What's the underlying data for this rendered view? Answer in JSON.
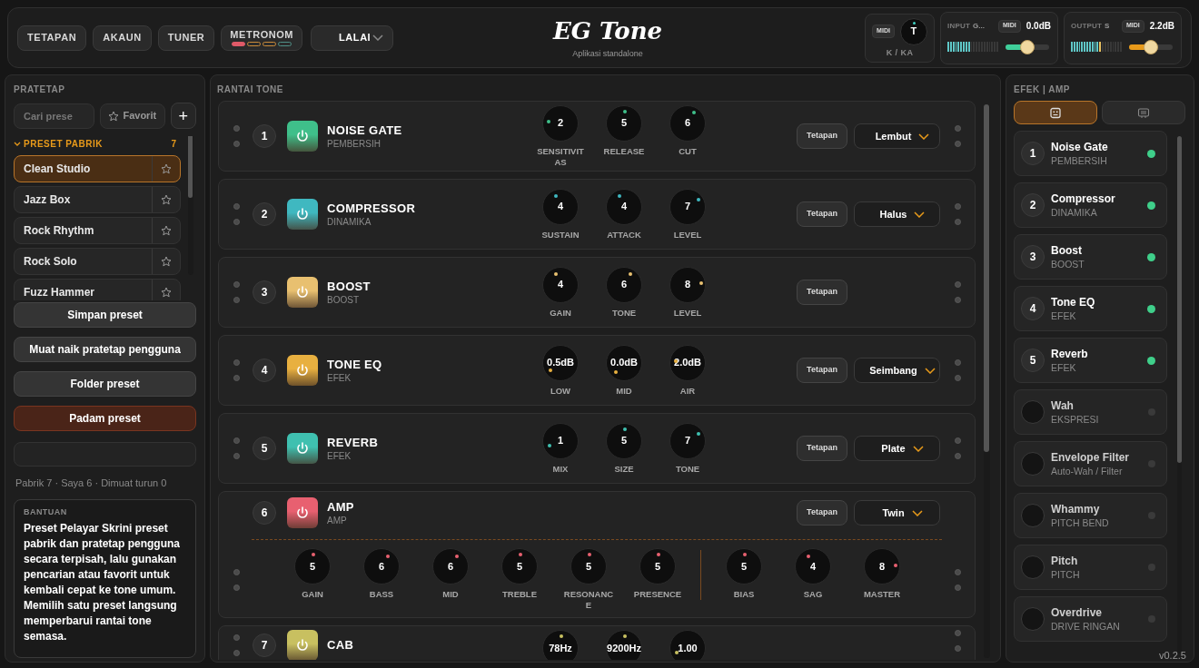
{
  "header": {
    "buttons": [
      "TETAPAN",
      "AKAUN",
      "TUNER"
    ],
    "metronome": {
      "label": "METRONOM",
      "beats": [
        {
          "color": "#e05a68",
          "on": true
        },
        {
          "color": "#c98a3a",
          "on": false
        },
        {
          "color": "#c98a3a",
          "on": false
        },
        {
          "color": "#4f8f86",
          "on": false
        }
      ]
    },
    "profile_select": {
      "value": "LALAI"
    },
    "logo": "EG Tone",
    "subtitle": "Aplikasi standalone",
    "midi_knob": {
      "midi": "MIDI",
      "knob": "T",
      "label": "K / KA"
    },
    "channels": [
      {
        "label": "INPUT",
        "name": "G...",
        "midi": "MIDI",
        "reading": "0.0dB",
        "meter": {
          "level": 0.45
        },
        "slider": {
          "level": 0.5
        },
        "color": "#3fcf9a"
      },
      {
        "label": "OUTPUT",
        "name": "S",
        "midi": "MIDI",
        "reading": "2.2dB",
        "meter": {
          "level": 0.6
        },
        "slider": {
          "level": 0.5
        },
        "color": "#e89a1a"
      }
    ]
  },
  "presets": {
    "title": "PRATETAP",
    "search": {
      "placeholder": "Cari prese"
    },
    "favorites_button": "Favorit",
    "add_button": "+",
    "group": {
      "title": "PRESET PABRIK",
      "count": "7",
      "expanded": true
    },
    "items": [
      {
        "name": "Clean Studio",
        "selected": true
      },
      {
        "name": "Jazz Box",
        "selected": false
      },
      {
        "name": "Rock Rhythm",
        "selected": false
      },
      {
        "name": "Rock Solo",
        "selected": false
      },
      {
        "name": "Fuzz Hammer",
        "selected": false
      }
    ],
    "actions": [
      {
        "label": "Simpan preset",
        "kind": "normal"
      },
      {
        "label": "Muat naik pratetap pengguna",
        "kind": "normal"
      },
      {
        "label": "Folder preset",
        "kind": "normal"
      },
      {
        "label": "Padam preset",
        "kind": "danger"
      }
    ],
    "stats": "Pabrik 7 · Saya 6 · Dimuat turun 0",
    "help": {
      "title": "BANTUAN",
      "text": "Preset Pelayar Skrini preset pabrik dan pratetap pengguna secara terpisah, lalu gunakan pencarian atau favorit untuk kembali cepat ke tone umum. Memilih satu preset langsung memperbarui rantai tone semasa."
    }
  },
  "chain": {
    "title": "RANTAI TONE",
    "modules": [
      {
        "kind": "standard",
        "number": "1",
        "name": "NOISE GATE",
        "category": "PEMBERSIH",
        "color": "#3fbf8a",
        "knobs": [
          {
            "label": "SENSITIVITAS",
            "value": "2"
          },
          {
            "label": "RELEASE",
            "value": "5"
          },
          {
            "label": "CUT",
            "value": "6"
          }
        ],
        "preset_button": "Tetapan",
        "variant": "Lembut"
      },
      {
        "kind": "standard",
        "number": "2",
        "name": "COMPRESSOR",
        "category": "DINAMIKA",
        "color": "#3fb8c0",
        "knobs": [
          {
            "label": "SUSTAIN",
            "value": "4"
          },
          {
            "label": "ATTACK",
            "value": "4"
          },
          {
            "label": "LEVEL",
            "value": "7"
          }
        ],
        "preset_button": "Tetapan",
        "variant": "Halus"
      },
      {
        "kind": "standard",
        "number": "3",
        "name": "BOOST",
        "category": "BOOST",
        "color": "#e8c070",
        "knobs": [
          {
            "label": "GAIN",
            "value": "4"
          },
          {
            "label": "TONE",
            "value": "6"
          },
          {
            "label": "LEVEL",
            "value": "8"
          }
        ],
        "preset_button": "Tetapan"
      },
      {
        "kind": "standard",
        "number": "4",
        "name": "TONE EQ",
        "category": "EFEK",
        "color": "#e8b040",
        "knobs": [
          {
            "label": "LOW",
            "value": "0.5dB"
          },
          {
            "label": "MID",
            "value": "0.0dB"
          },
          {
            "label": "AIR",
            "value": "2.0dB"
          }
        ],
        "preset_button": "Tetapan",
        "variant": "Seimbang"
      },
      {
        "kind": "standard",
        "number": "5",
        "name": "REVERB",
        "category": "EFEK",
        "color": "#3fc0b0",
        "knobs": [
          {
            "label": "MIX",
            "value": "1"
          },
          {
            "label": "SIZE",
            "value": "5"
          },
          {
            "label": "TONE",
            "value": "7"
          }
        ],
        "preset_button": "Tetapan",
        "variant": "Plate"
      },
      {
        "kind": "amp",
        "number": "6",
        "name": "AMP",
        "category": "AMP",
        "color": "#e86070",
        "knob_groups": [
          [
            {
              "label": "GAIN",
              "value": "5"
            },
            {
              "label": "BASS",
              "value": "6"
            },
            {
              "label": "MID",
              "value": "6"
            },
            {
              "label": "TREBLE",
              "value": "5"
            },
            {
              "label": "RESONANCE",
              "value": "5"
            },
            {
              "label": "PRESENCE",
              "value": "5"
            }
          ],
          [
            {
              "label": "BIAS",
              "value": "5"
            },
            {
              "label": "SAG",
              "value": "4"
            },
            {
              "label": "MASTER",
              "value": "8"
            }
          ]
        ],
        "preset_button": "Tetapan",
        "variant": "Twin"
      },
      {
        "kind": "standard",
        "number": "7",
        "name": "CAB",
        "color": "#c8c060",
        "knobs": [
          {
            "value": "78Hz"
          },
          {
            "value": "9200Hz"
          },
          {
            "value": "1.00"
          }
        ]
      }
    ]
  },
  "effects": {
    "title": "EFEK | AMP",
    "tabs": [
      {
        "selected": true
      },
      {
        "selected": false
      }
    ],
    "items": [
      {
        "number": "1",
        "name": "Noise Gate",
        "category": "PEMBERSIH",
        "active": true
      },
      {
        "number": "2",
        "name": "Compressor",
        "category": "DINAMIKA",
        "active": true
      },
      {
        "number": "3",
        "name": "Boost",
        "category": "BOOST",
        "active": true
      },
      {
        "number": "4",
        "name": "Tone EQ",
        "category": "EFEK",
        "active": true
      },
      {
        "number": "5",
        "name": "Reverb",
        "category": "EFEK",
        "active": true
      },
      {
        "name": "Wah",
        "category": "EKSPRESI",
        "active": false
      },
      {
        "name": "Envelope Filter",
        "category": "Auto-Wah / Filter",
        "active": false
      },
      {
        "name": "Whammy",
        "category": "PITCH BEND",
        "active": false
      },
      {
        "name": "Pitch",
        "category": "PITCH",
        "active": false
      },
      {
        "name": "Overdrive",
        "category": "DRIVE RINGAN",
        "active": false
      }
    ]
  },
  "version": "v0.2.5"
}
